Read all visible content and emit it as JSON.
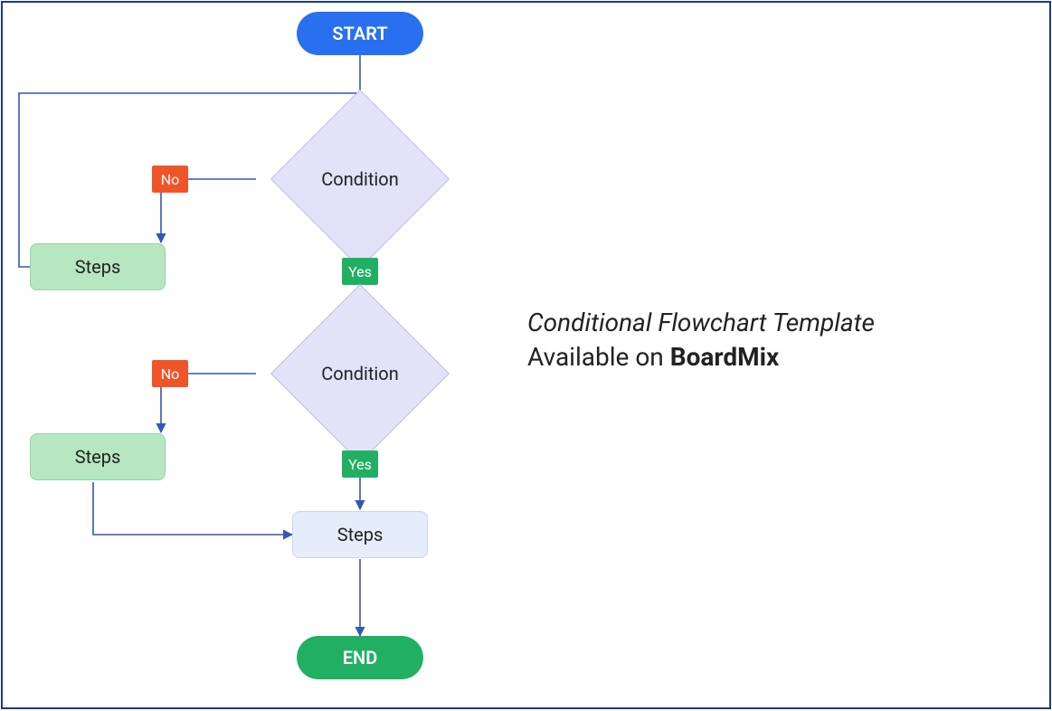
{
  "flow": {
    "start": "START",
    "end": "END",
    "condition1": "Condition",
    "condition2": "Condition",
    "steps1": "Steps",
    "steps2": "Steps",
    "steps3": "Steps",
    "no": "No",
    "yes": "Yes"
  },
  "caption": {
    "title": "Conditional Flowchart Template",
    "available": "Available on ",
    "brand": "BoardMix"
  },
  "colors": {
    "start_bg": "#2970f0",
    "end_bg": "#21b063",
    "diamond_bg": "#e3e2f9",
    "proc_green": "#b7e7c1",
    "proc_blue": "#e5ecfa",
    "no_bg": "#f0552a",
    "yes_bg": "#21b063",
    "line": "#3456b8"
  },
  "chart_data": {
    "type": "table",
    "description": "Conditional flowchart with two decision diamonds; each No branch goes to a Steps box, Yes branches continue; first Steps loops back above first Condition; second Steps joins into bottom Steps before END.",
    "nodes": [
      {
        "id": "start",
        "kind": "terminal",
        "label": "START"
      },
      {
        "id": "cond1",
        "kind": "decision",
        "label": "Condition"
      },
      {
        "id": "steps_no1",
        "kind": "process",
        "label": "Steps"
      },
      {
        "id": "cond2",
        "kind": "decision",
        "label": "Condition"
      },
      {
        "id": "steps_no2",
        "kind": "process",
        "label": "Steps"
      },
      {
        "id": "steps3",
        "kind": "process",
        "label": "Steps"
      },
      {
        "id": "end",
        "kind": "terminal",
        "label": "END"
      }
    ],
    "edges": [
      {
        "from": "start",
        "to": "cond1",
        "label": ""
      },
      {
        "from": "cond1",
        "to": "steps_no1",
        "label": "No"
      },
      {
        "from": "cond1",
        "to": "cond2",
        "label": "Yes"
      },
      {
        "from": "steps_no1",
        "to": "cond1",
        "label": "",
        "note": "loop back to edge above cond1"
      },
      {
        "from": "cond2",
        "to": "steps_no2",
        "label": "No"
      },
      {
        "from": "cond2",
        "to": "steps3",
        "label": "Yes"
      },
      {
        "from": "steps_no2",
        "to": "steps3",
        "label": ""
      },
      {
        "from": "steps3",
        "to": "end",
        "label": ""
      }
    ]
  }
}
